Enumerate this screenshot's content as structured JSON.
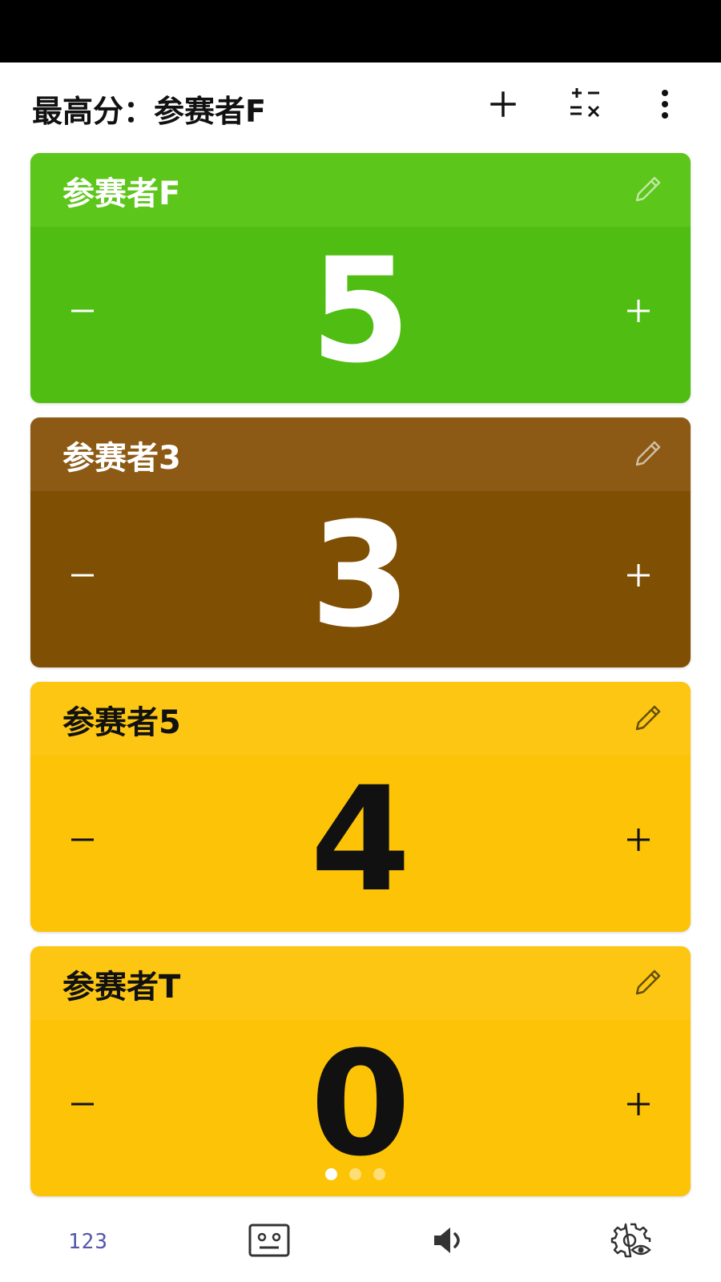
{
  "header": {
    "title": "最高分：参赛者F",
    "actions": [
      {
        "name": "add-player-button",
        "icon": "plus-icon"
      },
      {
        "name": "calculator-button",
        "icon": "calculator-icon"
      },
      {
        "name": "more-options-button",
        "icon": "more-vertical-icon"
      }
    ]
  },
  "players": [
    {
      "name": "参赛者F",
      "score": "5",
      "color": "#4fbd12",
      "header_color": "#5cc61a",
      "text_color": "#ffffff"
    },
    {
      "name": "参赛者3",
      "score": "3",
      "color": "#7f4f04",
      "header_color": "#8c5a15",
      "text_color": "#ffffff"
    },
    {
      "name": "参赛者5",
      "score": "4",
      "color": "#fcc307",
      "header_color": "#fcc612",
      "text_color": "#111111"
    },
    {
      "name": "参赛者T",
      "score": "0",
      "color": "#fcc307",
      "header_color": "#fcc612",
      "text_color": "#111111"
    }
  ],
  "pager": {
    "pages": 3,
    "active": 0
  },
  "bottom_nav": {
    "counter_label": "123",
    "items": [
      {
        "name": "nav-counter",
        "icon": "counter-icon"
      },
      {
        "name": "nav-robot",
        "icon": "robot-face-icon"
      },
      {
        "name": "nav-sound",
        "icon": "speaker-icon"
      },
      {
        "name": "nav-settings",
        "icon": "settings-eye-icon"
      }
    ]
  },
  "colors": {
    "status_bar": "#000000",
    "background": "#ffffff",
    "nav_accent": "#5558a8",
    "icon_dark": "#333333"
  }
}
